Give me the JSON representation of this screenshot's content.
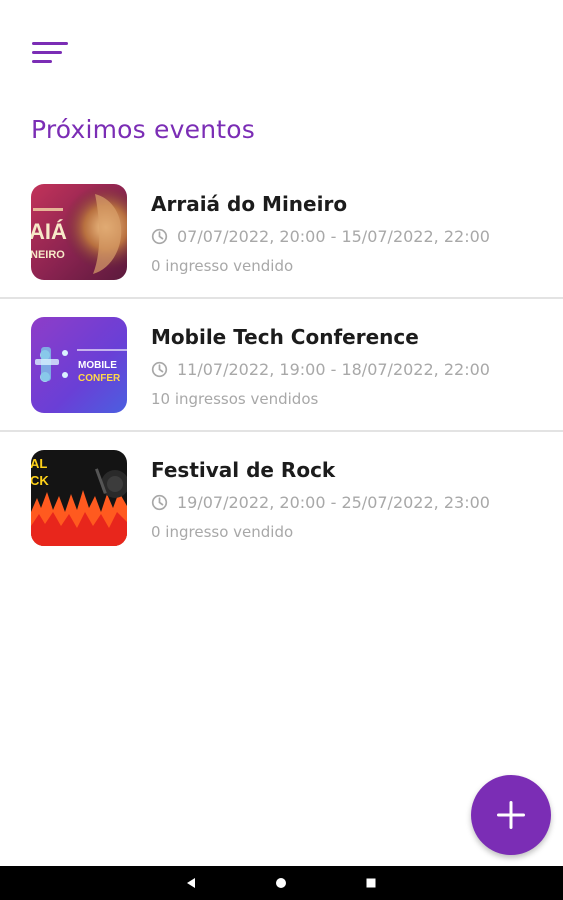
{
  "header": {
    "menu_icon": "menu-icon",
    "section_title": "Próximos eventos"
  },
  "events": [
    {
      "name": "Arraiá do Mineiro",
      "date_range": "07/07/2022, 20:00 - 15/07/2022, 22:00",
      "sold": "0 ingresso vendido",
      "thumb_text": [
        "AIÁ",
        "NEIRO"
      ]
    },
    {
      "name": "Mobile Tech Conference",
      "date_range": "11/07/2022, 19:00 - 18/07/2022, 22:00",
      "sold": "10 ingressos vendidos",
      "thumb_text": [
        "MOBILE",
        "CONFER"
      ]
    },
    {
      "name": "Festival de Rock",
      "date_range": "19/07/2022, 20:00 - 25/07/2022, 23:00",
      "sold": "0 ingresso vendido",
      "thumb_text": [
        "AL",
        "CK"
      ]
    }
  ],
  "fab": {
    "icon": "plus-icon"
  },
  "navigation": {
    "back_icon": "back-icon",
    "home_icon": "home-icon",
    "recents_icon": "recents-icon"
  },
  "colors": {
    "accent": "#7B2DB5",
    "secondary_text": "#a8a8a8",
    "primary_text": "#1c1c1c"
  }
}
